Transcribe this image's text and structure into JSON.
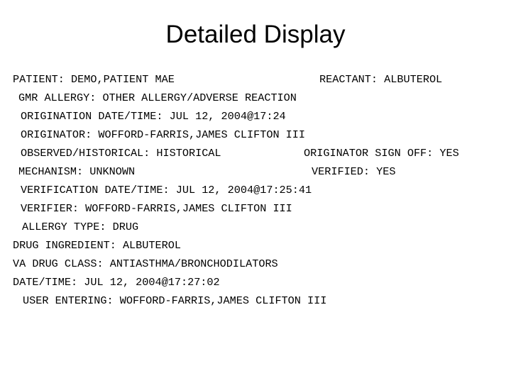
{
  "slide": {
    "title": "Detailed Display",
    "background_color": "#ffffff",
    "text_color": "#000000"
  },
  "record": {
    "lines": [
      {
        "left": "PATIENT: DEMO,PATIENT MAE",
        "right": "REACTANT: ALBUTEROL",
        "name": "patient"
      },
      {
        "left": "GMR ALLERGY: OTHER ALLERGY/ADVERSE REACTION",
        "right": "",
        "name": "gmr-allergy"
      },
      {
        "left": "ORIGINATION DATE/TIME: JUL 12, 2004@17:24",
        "right": "",
        "name": "origination-date-time"
      },
      {
        "left": "ORIGINATOR: WOFFORD-FARRIS,JAMES CLIFTON III",
        "right": "",
        "name": "originator"
      },
      {
        "left": "OBSERVED/HISTORICAL: HISTORICAL",
        "right": "ORIGINATOR SIGN OFF: YES",
        "name": "observed-historical"
      },
      {
        "left": "MECHANISM: UNKNOWN",
        "right": "VERIFIED: YES",
        "name": "mechanism"
      },
      {
        "left": "VERIFICATION DATE/TIME: JUL 12, 2004@17:25:41",
        "right": "",
        "name": "verification-date-time"
      },
      {
        "left": "VERIFIER: WOFFORD-FARRIS,JAMES CLIFTON III",
        "right": "",
        "name": "verifier"
      },
      {
        "left": "ALLERGY TYPE: DRUG",
        "right": "",
        "name": "allergy-type"
      },
      {
        "left": "DRUG INGREDIENT: ALBUTEROL",
        "right": "",
        "name": "drug-ingredient"
      },
      {
        "left": "VA DRUG CLASS: ANTIASTHMA/BRONCHODILATORS",
        "right": "",
        "name": "va-drug-class"
      },
      {
        "left": "DATE/TIME: JUL 12, 2004@17:27:02",
        "right": "",
        "name": "date-time"
      },
      {
        "left": "USER ENTERING: WOFFORD-FARRIS,JAMES CLIFTON III",
        "right": "",
        "name": "user-entering"
      }
    ]
  }
}
